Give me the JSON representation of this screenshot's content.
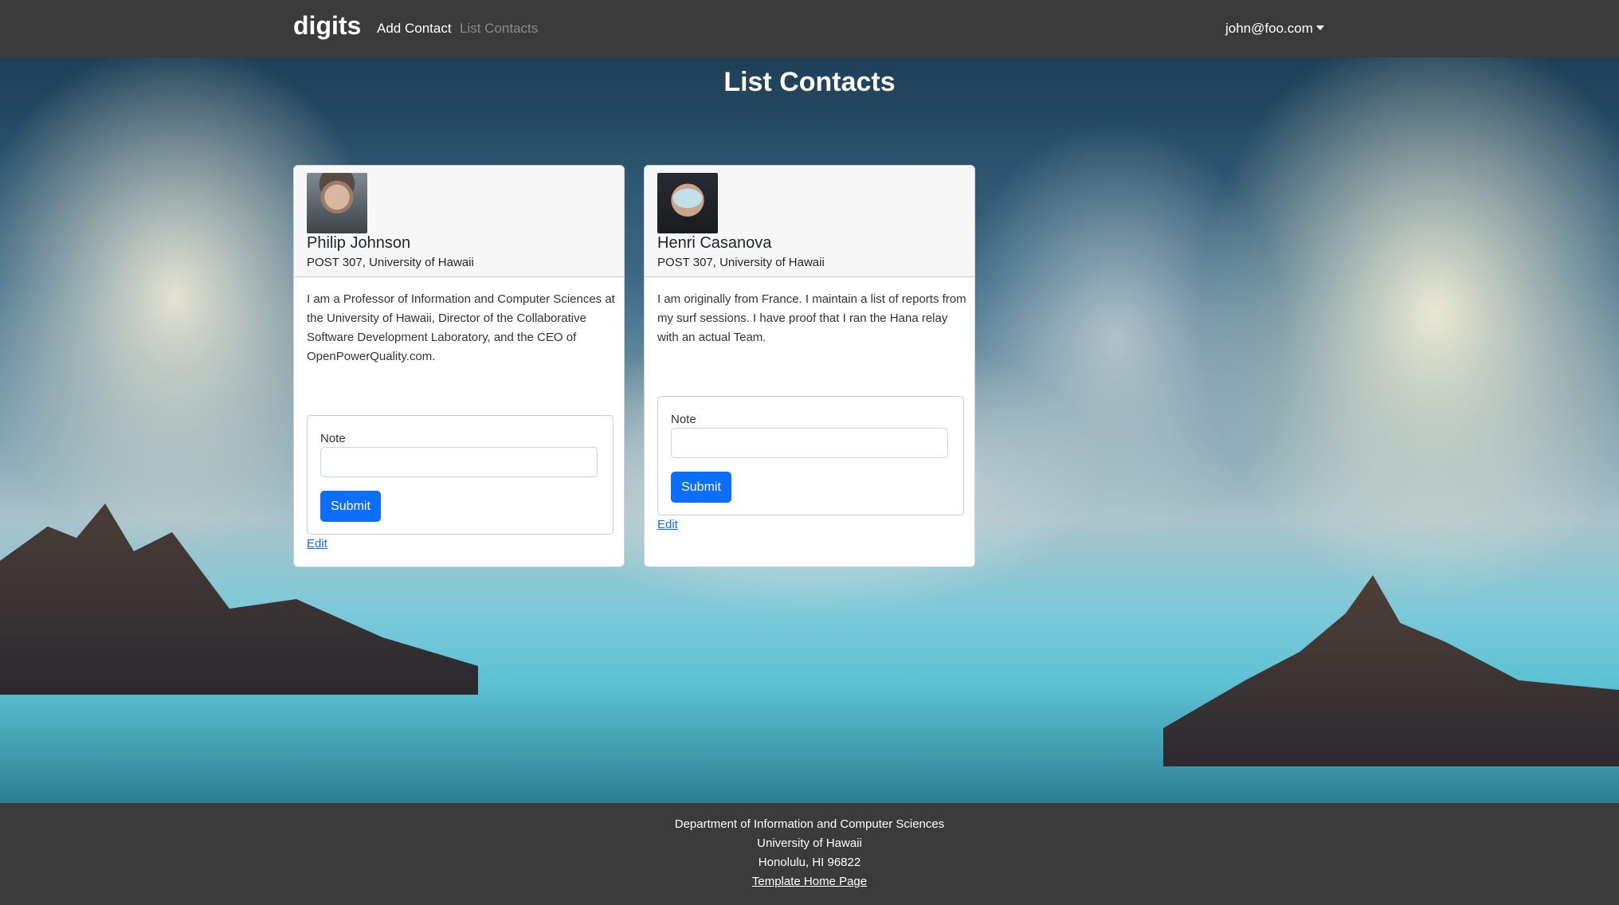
{
  "navbar": {
    "brand": "digits",
    "links": [
      {
        "label": "Add Contact"
      },
      {
        "label": "List Contacts"
      }
    ],
    "user": "john@foo.com"
  },
  "page": {
    "title": "List Contacts"
  },
  "contacts": [
    {
      "name": "Philip Johnson",
      "address": "POST 307, University of Hawaii",
      "description": "I am a Professor of Information and Computer Sciences at the University of Hawaii, Director of the Collaborative Software Development Laboratory, and the CEO of OpenPowerQuality.com.",
      "note_label": "Note",
      "note_value": "",
      "submit_label": "Submit",
      "edit_label": "Edit"
    },
    {
      "name": "Henri Casanova",
      "address": "POST 307, University of Hawaii",
      "description": "I am originally from France. I maintain a list of reports from my surf sessions. I have proof that I ran the Hana relay with an actual Team.",
      "note_label": "Note",
      "note_value": "",
      "submit_label": "Submit",
      "edit_label": "Edit"
    }
  ],
  "footer": {
    "line1": "Department of Information and Computer Sciences",
    "line2": "University of Hawaii",
    "line3": "Honolulu, HI 96822",
    "link": "Template Home Page"
  },
  "colors": {
    "navbar_bg": "#3b3b3b",
    "primary": "#0d6efd"
  }
}
